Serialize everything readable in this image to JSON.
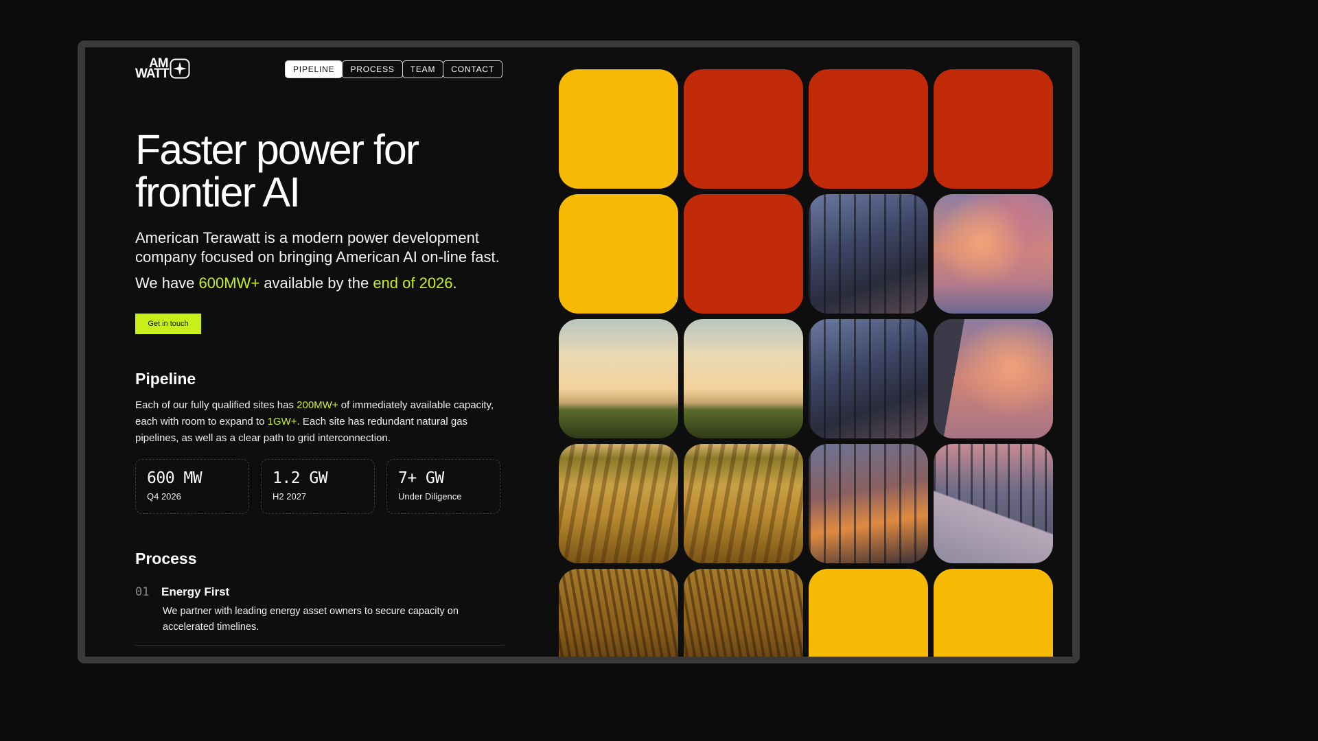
{
  "brand": {
    "logo_line1": "AM",
    "logo_line2": "WATT"
  },
  "nav": [
    {
      "label": "PIPELINE",
      "active": true
    },
    {
      "label": "PROCESS",
      "active": false
    },
    {
      "label": "TEAM",
      "active": false
    },
    {
      "label": "CONTACT",
      "active": false
    }
  ],
  "hero": {
    "title_line1": "Faster power for",
    "title_line2": "frontier AI",
    "description": "American Terawatt is a modern power development company focused on bringing American AI on-line fast.",
    "avail_pre": "We have ",
    "avail_amount": "600MW+",
    "avail_mid": " available by the ",
    "avail_date": "end of 2026",
    "avail_post": ".",
    "cta_label": "Get in touch"
  },
  "pipeline": {
    "title": "Pipeline",
    "body_pre": "Each of our fully qualified sites has ",
    "body_hl1": "200MW+",
    "body_mid": " of immediately available capacity, each with room to expand to ",
    "body_hl2": "1GW+",
    "body_post": ". Each site has redundant natural gas pipelines, as well as a clear path to grid interconnection.",
    "stats": [
      {
        "value": "600 MW",
        "label": "Q4 2026"
      },
      {
        "value": "1.2 GW",
        "label": "H2 2027"
      },
      {
        "value": "7+ GW",
        "label": "Under Diligence"
      }
    ]
  },
  "process": {
    "title": "Process",
    "steps": [
      {
        "number": "01",
        "title": "Energy First",
        "description": "We partner with leading energy asset owners to secure capacity on accelerated timelines."
      }
    ]
  },
  "colors": {
    "accent": "#c8ef1a",
    "tile_yellow": "#f6b904",
    "tile_red": "#c22b0a",
    "background": "#0e0e0e"
  },
  "tiles": [
    "yellow",
    "red",
    "red",
    "red",
    "yellow",
    "red",
    "building",
    "clouds",
    "field-top",
    "field-top",
    "building",
    "clouds-bldg",
    "field-mid",
    "field-mid",
    "building-warm",
    "walkway",
    "field-low",
    "field-low",
    "yellow",
    "yellow"
  ]
}
